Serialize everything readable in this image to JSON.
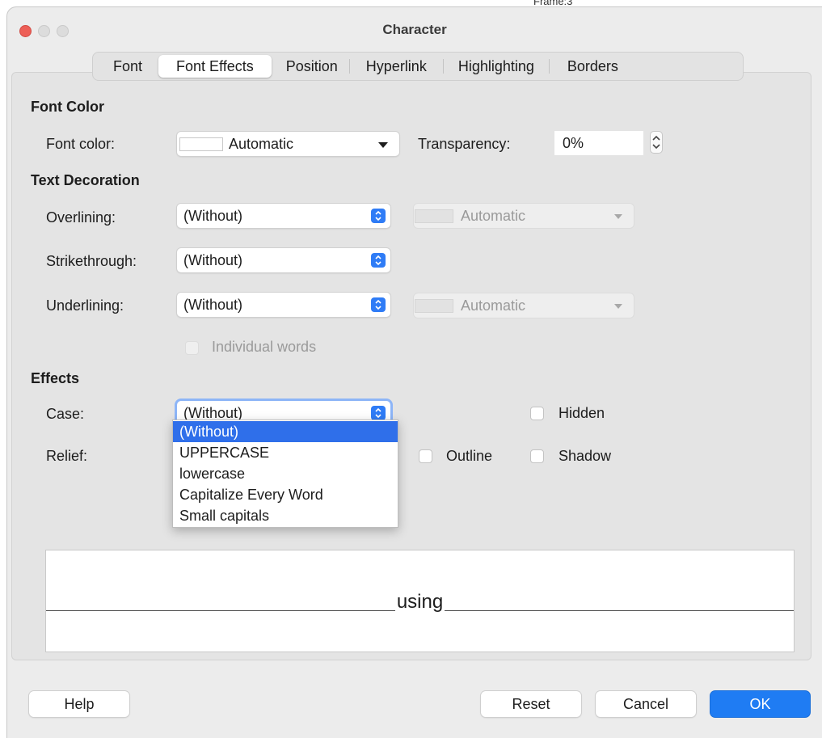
{
  "background": {
    "fragment": "Frame:3"
  },
  "window": {
    "title": "Character"
  },
  "tabs": [
    "Font",
    "Font Effects",
    "Position",
    "Hyperlink",
    "Highlighting",
    "Borders"
  ],
  "active_tab": "Font Effects",
  "font_color_section": {
    "heading": "Font Color",
    "font_color_label": "Font color:",
    "font_color_value": "Automatic",
    "transparency_label": "Transparency:",
    "transparency_value": "0%"
  },
  "text_decoration": {
    "heading": "Text Decoration",
    "overlining_label": "Overlining:",
    "overlining_value": "(Without)",
    "overline_color": "Automatic",
    "strikethrough_label": "Strikethrough:",
    "strikethrough_value": "(Without)",
    "underlining_label": "Underlining:",
    "underlining_value": "(Without)",
    "underline_color": "Automatic",
    "individual_words_label": "Individual words"
  },
  "effects": {
    "heading": "Effects",
    "case_label": "Case:",
    "case_value": "(Without)",
    "relief_label": "Relief:",
    "hidden_label": "Hidden",
    "outline_label": "Outline",
    "shadow_label": "Shadow",
    "case_options": [
      "(Without)",
      "UPPERCASE",
      "lowercase",
      "Capitalize Every Word",
      "Small capitals"
    ]
  },
  "preview": {
    "text": "using"
  },
  "buttons": {
    "help": "Help",
    "reset": "Reset",
    "cancel": "Cancel",
    "ok": "OK"
  },
  "colors": {
    "accent": "#2f7cf6",
    "selection": "#2f6fea",
    "close": "#ed5f57"
  }
}
